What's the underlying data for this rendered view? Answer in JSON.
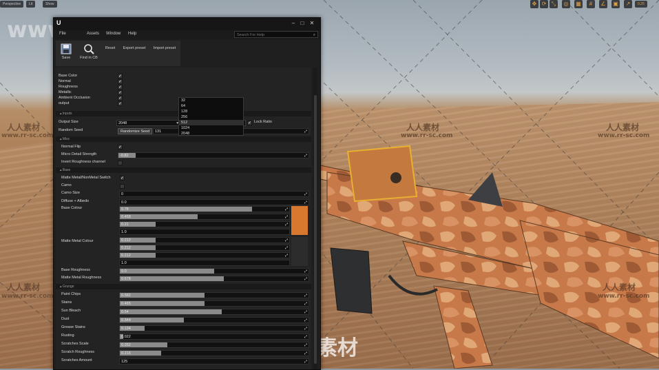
{
  "viewport": {
    "buttons": [
      "Perspective",
      "Lit",
      "Show"
    ],
    "tool_icons": [
      "move-icon",
      "rotate-icon",
      "scale-icon",
      "world-icon",
      "snap-icon",
      "grid-snap-icon",
      "angle-snap-icon",
      "scale-snap-icon",
      "camera-speed-icon"
    ],
    "zoom_readout": "0.25",
    "camo_colors": [
      "#c8794a",
      "#e0a877",
      "#9e5a35",
      "#d99263"
    ]
  },
  "watermarks": {
    "top": "www.rr-sc.com",
    "cn": "人人素材",
    "url": "www.rr-sc.com",
    "bottom_logo": "人人素材"
  },
  "editor": {
    "title_buttons": [
      "minimize",
      "maximize",
      "close"
    ],
    "menu": [
      "File",
      "Assets",
      "Window",
      "Help"
    ],
    "search_placeholder": "Search For Help",
    "toolbar": [
      {
        "label": "Save",
        "icon": "save-icon"
      },
      {
        "label": "Find in CB",
        "icon": "find-in-content-browser-icon"
      },
      {
        "label": "Reset",
        "icon": ""
      },
      {
        "label": "Export preset",
        "icon": ""
      },
      {
        "label": "Import preset",
        "icon": ""
      }
    ],
    "outputs": [
      {
        "label": "Base Color",
        "checked": true
      },
      {
        "label": "Normal",
        "checked": true
      },
      {
        "label": "Roughness",
        "checked": true
      },
      {
        "label": "Metallic",
        "checked": true
      },
      {
        "label": "Ambient Occlusion",
        "checked": true
      },
      {
        "label": "output",
        "checked": true
      }
    ],
    "inputs_section": "Inputs",
    "output_size": {
      "label": "Output Size",
      "value_a": "2048",
      "value_b": "2048",
      "lock_label": "Lock Ratio"
    },
    "random_seed": {
      "label": "Random Seed",
      "button": "Randomize Seed",
      "value": "131"
    },
    "size_options": [
      "32",
      "64",
      "128",
      "256",
      "512",
      "1024",
      "2048"
    ],
    "misc_section": "Misc",
    "misc": {
      "normal_flip": {
        "label": "Normal Flip",
        "checked": true
      },
      "micro_detail": {
        "label": "Micro Detail Strength",
        "value": "-0.82",
        "fill": 0.09
      },
      "invert_roughness": {
        "label": "Invert Roughness channel",
        "checked": false
      }
    },
    "base_section": "Base",
    "base": {
      "matte_switch": {
        "label": "Matte Metal/NonMetal Switch",
        "checked": true
      },
      "camo": {
        "label": "Camo",
        "checked": false
      },
      "camo_size": {
        "label": "Camo Size",
        "value": "0",
        "fill": 0.0
      },
      "diffuse_albedo": {
        "label": "Diffuse + Albedo",
        "value": "0.0",
        "fill": 0.0
      },
      "base_colour": {
        "label": "Base Colour",
        "channels": [
          {
            "value": "0.78",
            "fill": 0.78
          },
          {
            "value": "0.458",
            "fill": 0.46
          },
          {
            "value": "0.21",
            "fill": 0.21
          },
          {
            "value": "1.0",
            "fill": 0.0
          }
        ],
        "swatch": "#d8782e"
      },
      "matte_metal_colour": {
        "label": "Matte Metal Colour",
        "channels": [
          {
            "value": "0.212",
            "fill": 0.21
          },
          {
            "value": "0.212",
            "fill": 0.21
          },
          {
            "value": "0.212",
            "fill": 0.21
          },
          {
            "value": "1.0",
            "fill": 0.0
          }
        ],
        "swatch": "#2c2c2c"
      },
      "base_roughness": {
        "label": "Base Roughness",
        "value": "0.0",
        "fill": 0.5
      },
      "matte_metal_roughness": {
        "label": "Matte Metal Roughness",
        "value": "0.678",
        "fill": 0.55
      }
    },
    "grunge_section": "Grunge",
    "grunge": [
      {
        "label": "Paint Chips",
        "value": "0.582",
        "fill": 0.45
      },
      {
        "label": "Stains",
        "value": "0.465",
        "fill": 0.45
      },
      {
        "label": "Sun Bleach",
        "value": "0.54",
        "fill": 0.54
      },
      {
        "label": "Dust",
        "value": "0.344",
        "fill": 0.34
      },
      {
        "label": "Grease Stains",
        "value": "0.134",
        "fill": 0.13
      },
      {
        "label": "Rusting",
        "value": "0.022",
        "fill": 0.02
      },
      {
        "label": "Scratches Scale",
        "value": "0.252",
        "fill": 0.25
      },
      {
        "label": "Scratch Roughness",
        "value": "0.216",
        "fill": 0.22
      },
      {
        "label": "Scratches Amount",
        "value": "125",
        "fill": 0.0
      }
    ]
  }
}
